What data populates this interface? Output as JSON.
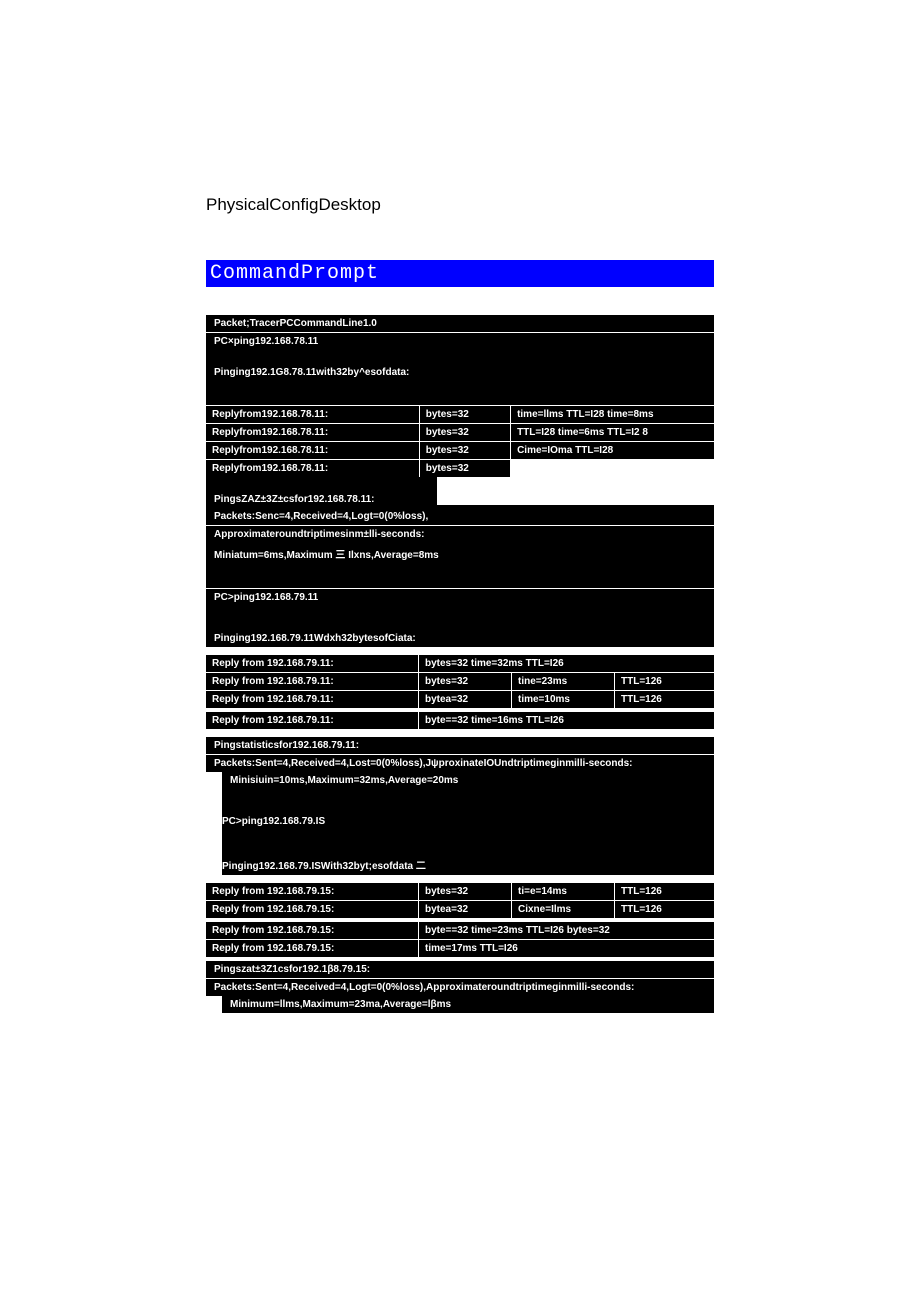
{
  "tabs": "PhysicalConfigDesktop",
  "title": "CommandPrompt",
  "block1": {
    "l1": "Packet;TracerPCCommandLine1.0",
    "l2": "PC×ping192.168.78.11",
    "l3": "Pinging192.1G8.78.11with32by^esofdata:",
    "rows": [
      {
        "a": "Replyfrom192.168.78.11:",
        "b": "bytes=32",
        "c": "time=llms TTL=I28 time=8ms"
      },
      {
        "a": "Replyfrom192.168.78.11:",
        "b": "bytes=32",
        "c": "TTL=I28 time=6ms TTL=I2 8"
      },
      {
        "a": "Replyfrom192.168.78.11:",
        "b": "bytes=32",
        "c": "Cime=IOma TTL=I28"
      },
      {
        "a": "Replyfrom192.168.78.11:",
        "b": "bytes=32",
        "c": ""
      }
    ],
    "stats1": "PingsZAZ±3Z±csfor192.168.78.11:",
    "stats2": "Packets:Senc=4,Received=4,Logt=0(0%loss),",
    "stats3": "Approximateroundtriptimesinm±lli-seconds:",
    "stats4": "Miniatum=6ms,Maximum 三 Ilxns,Average=8ms"
  },
  "block2": {
    "l1": "PC>ping192.168.79.11",
    "l2": "Pinging192.168.79.11Wdxh32bytesofCiata:",
    "r1": {
      "a": "Reply from 192.168.79.11:",
      "b": "bytes=32 time=32ms TTL=I26"
    },
    "r2": {
      "a": "Reply from 192.168.79.11:",
      "b": "bytes=32",
      "c": "tine=23ms",
      "d": "TTL=126"
    },
    "r3": {
      "a": "Reply from 192.168.79.11:",
      "b": "bytea=32",
      "c": "time=10ms",
      "d": "TTL=126"
    },
    "r4": {
      "a": "Reply from 192.168.79.11:",
      "b": "byte==32 time=16ms TTL=I26"
    },
    "stats1": "Pingstatisticsfor192.168.79.11:",
    "stats2": "Packets:Sent=4,Received=4,Lost=0(0%loss),JψproxinateIOUndtriptimeginmilli-seconds:",
    "stats3": "Minisiuin=10ms,Maximum=32ms,Average=20ms"
  },
  "block3": {
    "l1": "PC>ping192.168.79.IS",
    "l2": "Pinging192.168.79.ISWith32byt;esofdata 二",
    "r1": {
      "a": "Reply from 192.168.79.15:",
      "b": "bytes=32",
      "c": "ti=e=14ms",
      "d": "TTL=126"
    },
    "r2": {
      "a": "Reply from 192.168.79.15:",
      "b": "bytea=32",
      "c": "Cixne=Ilms",
      "d": "TTL=126"
    },
    "r3": {
      "a": "Reply from 192.168.79.15:",
      "b": "byte==32 time=23ms TTL=I26 bytes=32"
    },
    "r4": {
      "a": "Reply from 192.168.79.15:",
      "b": "time=17ms TTL=I26"
    },
    "stats1": "Pingszat±3Z1csfor192.1β8.79.15:",
    "stats2": "Packets:Sent=4,Received=4,Logt=0(0%loss),Approximateroundtriptimeginmilli-seconds:",
    "stats3": "Minimum=llms,Maximum=23ma,Average=lβms"
  }
}
